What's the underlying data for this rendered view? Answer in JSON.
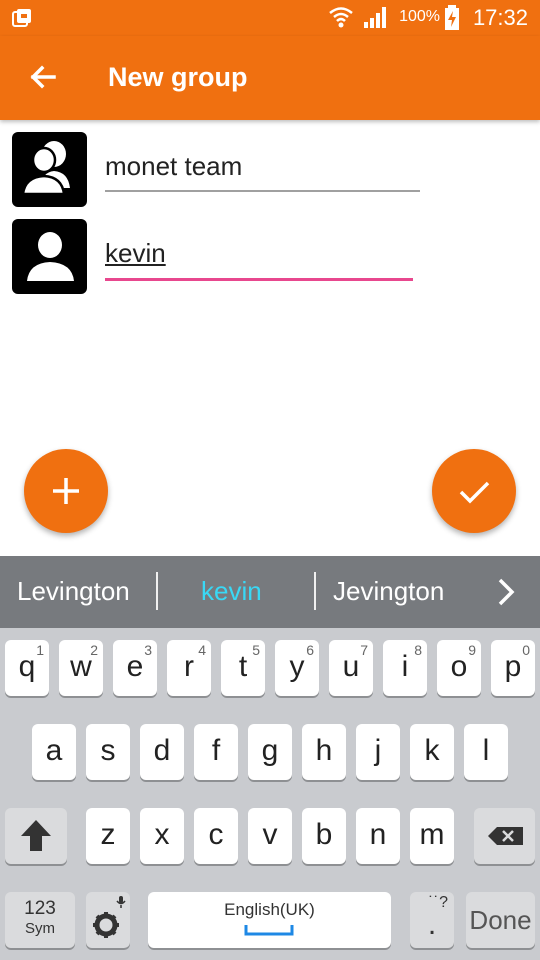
{
  "status_bar": {
    "time": "17:32",
    "battery": "100%",
    "icons": [
      "sim-icon",
      "wifi-icon",
      "signal-icon",
      "battery-charging-icon"
    ]
  },
  "app_bar": {
    "title": "New group",
    "back_icon": "arrow-left-icon",
    "color": "#f07010"
  },
  "form": {
    "group_name": "monet team",
    "member_name": "kevin"
  },
  "actions": {
    "add_icon": "plus-icon",
    "confirm_icon": "check-icon"
  },
  "suggestions": [
    "Levington",
    "kevin",
    "Jevington"
  ],
  "keyboard": {
    "row1": [
      "q",
      "w",
      "e",
      "r",
      "t",
      "y",
      "u",
      "i",
      "o",
      "p"
    ],
    "row1_nums": [
      "1",
      "2",
      "3",
      "4",
      "5",
      "6",
      "7",
      "8",
      "9",
      "0"
    ],
    "row2": [
      "a",
      "s",
      "d",
      "f",
      "g",
      "h",
      "j",
      "k",
      "l"
    ],
    "row3": [
      "z",
      "x",
      "c",
      "v",
      "b",
      "n",
      "m"
    ],
    "sym_label_1": "123",
    "sym_label_2": "Sym",
    "space_label": "English(UK)",
    "punct_top": "˙˙?",
    "punct_bottom": ".",
    "done_label": "Done",
    "icons": [
      "shift-icon",
      "backspace-icon",
      "settings-icon",
      "mic-icon"
    ]
  },
  "colors": {
    "accent": "#f07010",
    "focus_line": "#e8478e",
    "suggestion_highlight": "#39d8f5"
  }
}
